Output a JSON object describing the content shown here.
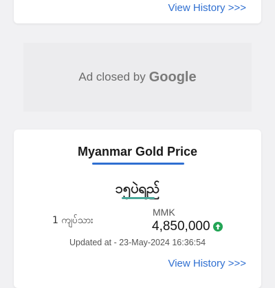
{
  "top_card": {
    "view_history": "View History >>>"
  },
  "ad": {
    "text": "Ad closed by",
    "brand": "Google"
  },
  "gold_card": {
    "title": "Myanmar Gold Price",
    "unit_label": "၁၅ပဲရည်",
    "weight_label": "1 ကျပ်သား",
    "currency": "MMK",
    "price": "4,850,000",
    "trend": "up",
    "updated": "Updated at - 23-May-2024 16:36:54",
    "view_history": "View History >>>"
  },
  "colors": {
    "accent": "#2f6fd1",
    "teal": "#4aa89a",
    "up": "#23a455"
  }
}
